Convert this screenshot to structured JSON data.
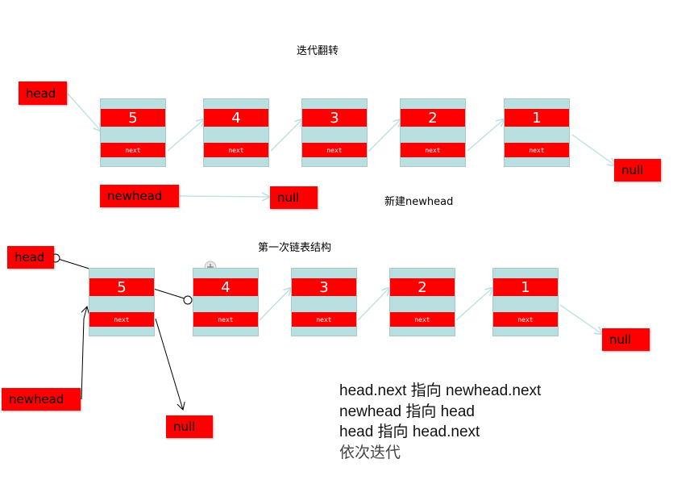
{
  "title_top": "迭代翻转",
  "caption_new": "新建newhead",
  "title_bottom": "第一次链表结构",
  "row1": {
    "values": [
      "5",
      "4",
      "3",
      "2",
      "1"
    ],
    "next_label": "next",
    "head": "head",
    "null_end": "null",
    "newhead": "newhead",
    "newhead_null": "null"
  },
  "row2": {
    "values": [
      "5",
      "4",
      "3",
      "2",
      "1"
    ],
    "next_label": "next",
    "head": "head",
    "null_end": "null",
    "newhead": "newhead",
    "node5_null": "null"
  },
  "notes": [
    "head.next 指向 newhead.next",
    "newhead 指向 head",
    "head 指向 head.next",
    "依次迭代"
  ],
  "colors": {
    "node_bg": "#b9dfe1",
    "red": "#ff0000",
    "connector": "#b9dfe1"
  }
}
